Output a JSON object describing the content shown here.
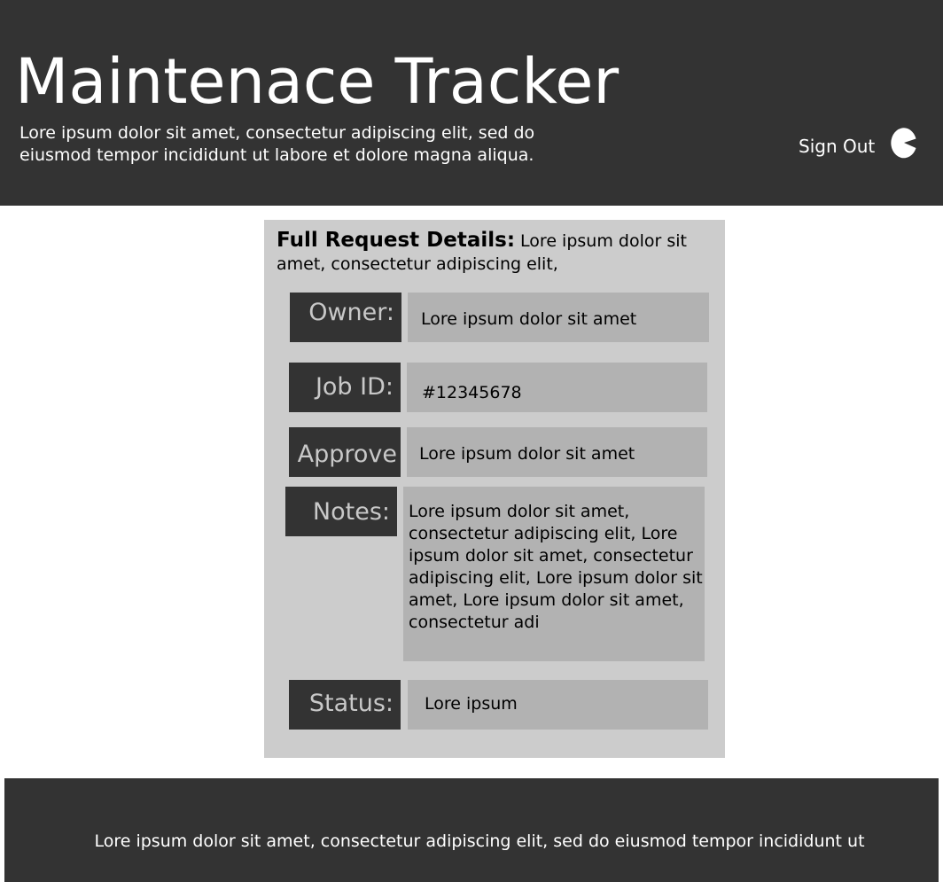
{
  "header": {
    "title": "Maintenace Tracker",
    "subtitle": "Lore ipsum dolor sit amet, consectetur adipiscing elit, sed do eiusmod tempor incididunt ut labore et dolore magna aliqua.",
    "sign_out_label": "Sign Out",
    "sign_out_icon": "pie-chart-icon"
  },
  "details": {
    "heading_bold": "Full Request Details:",
    "heading_text": " Lore ipsum dolor sit amet, consectetur adipiscing elit,",
    "fields": {
      "owner": {
        "label": "Owner:",
        "value": "Lore ipsum dolor sit amet"
      },
      "job_id": {
        "label": "Job ID:",
        "value": "#12345678"
      },
      "approve": {
        "label": "Approve",
        "value": "Lore ipsum dolor sit amet"
      },
      "notes": {
        "label": "Notes:",
        "value": "Lore ipsum dolor sit amet, consectetur adipiscing elit, Lore ipsum dolor sit amet, consectetur adipiscing elit, Lore ipsum dolor sit amet, Lore ipsum dolor sit amet, consectetur adi"
      },
      "status": {
        "label": "Status:",
        "value": "Lore ipsum"
      }
    }
  },
  "footer": {
    "text": "Lore ipsum dolor sit amet, consectetur adipiscing elit, sed do eiusmod tempor incididunt ut"
  },
  "colors": {
    "header_bg": "#333333",
    "panel_bg": "#cccccc",
    "label_bg": "#333333",
    "label_text": "#c8c8c8",
    "value_bg": "#b2b2b2"
  }
}
